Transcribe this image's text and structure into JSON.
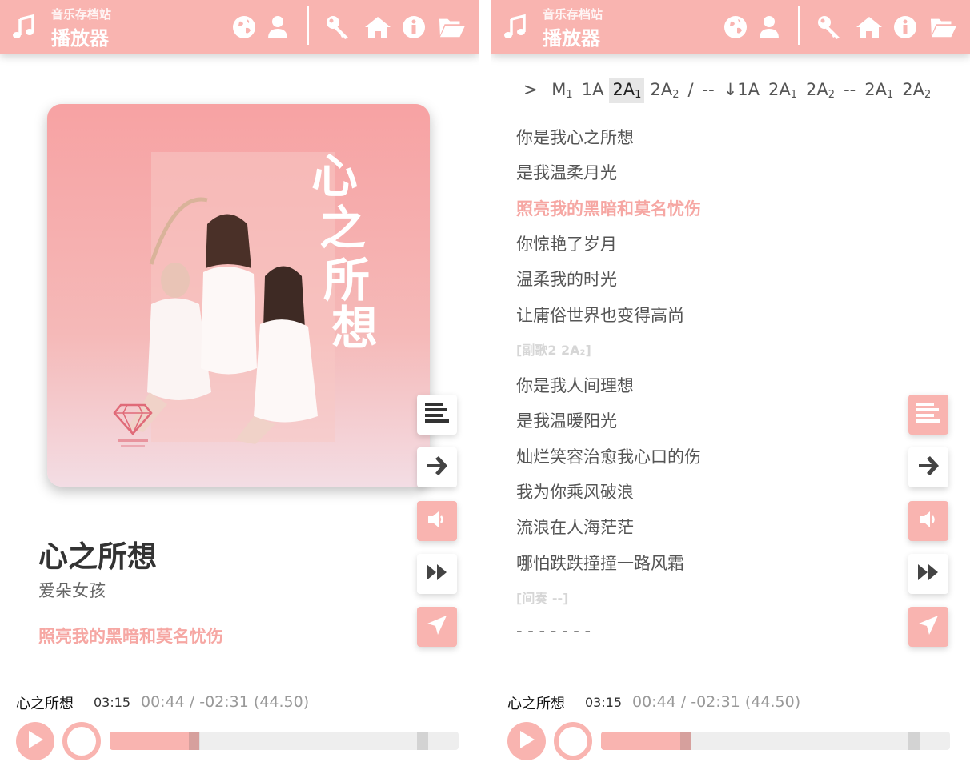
{
  "header": {
    "site_name": "音乐存档站",
    "page_name": "播放器",
    "icons": [
      "music-note-icon",
      "globe-icon",
      "user-icon",
      "key-icon",
      "home-icon",
      "info-icon",
      "folder-open-icon"
    ]
  },
  "colors": {
    "accent": "#f9b4b0",
    "lyric_current": "#f6a7a3",
    "text_dark": "#333333",
    "text_muted": "#999999"
  },
  "now_playing": {
    "title": "心之所想",
    "artist": "爱朵女孩",
    "current_lyric": "照亮我的黑暗和莫名忧伤",
    "cover_text": "心之所想"
  },
  "side_buttons": [
    {
      "icon": "align-left-icon"
    },
    {
      "icon": "arrow-right-icon"
    },
    {
      "icon": "volume-icon"
    },
    {
      "icon": "fast-forward-icon"
    },
    {
      "icon": "send-icon"
    }
  ],
  "player": {
    "title": "心之所想",
    "duration": "03:15",
    "time_text": "00:44 / -02:31 (44.50)",
    "progress_fraction": 0.226,
    "buffered_fraction": 0.26,
    "marker_fraction": 0.88
  },
  "lyrics_panel": {
    "prefix": ">",
    "sections": [
      {
        "base": "M",
        "sub": "1"
      },
      {
        "base": "1A",
        "sub": ""
      },
      {
        "base": "2A",
        "sub": "1",
        "active": true
      },
      {
        "base": "2A",
        "sub": "2"
      },
      {
        "base": "/",
        "sub": ""
      },
      {
        "base": "--",
        "sub": ""
      },
      {
        "base": "↓1A",
        "sub": ""
      },
      {
        "base": "2A",
        "sub": "1"
      },
      {
        "base": "2A",
        "sub": "2"
      },
      {
        "base": "--",
        "sub": ""
      },
      {
        "base": "2A",
        "sub": "1"
      },
      {
        "base": "2A",
        "sub": "2"
      }
    ],
    "lines": [
      {
        "text": "你是我心之所想",
        "type": "line"
      },
      {
        "text": "是我温柔月光",
        "type": "line"
      },
      {
        "text": "照亮我的黑暗和莫名忧伤",
        "type": "current"
      },
      {
        "text": "你惊艳了岁月",
        "type": "line"
      },
      {
        "text": "温柔我的时光",
        "type": "line"
      },
      {
        "text": "让庸俗世界也变得高尚",
        "type": "line"
      },
      {
        "text": "[副歌2 2A₂]",
        "type": "section"
      },
      {
        "text": "你是我人间理想",
        "type": "line"
      },
      {
        "text": "是我温暖阳光",
        "type": "line"
      },
      {
        "text": "灿烂笑容治愈我心口的伤",
        "type": "line"
      },
      {
        "text": "我为你乘风破浪",
        "type": "line"
      },
      {
        "text": "流浪在人海茫茫",
        "type": "line"
      },
      {
        "text": "哪怕跌跌撞撞一路风霜",
        "type": "line"
      },
      {
        "text": "[间奏 --]",
        "type": "section"
      },
      {
        "text": "- - - - - - -",
        "type": "line"
      }
    ]
  }
}
